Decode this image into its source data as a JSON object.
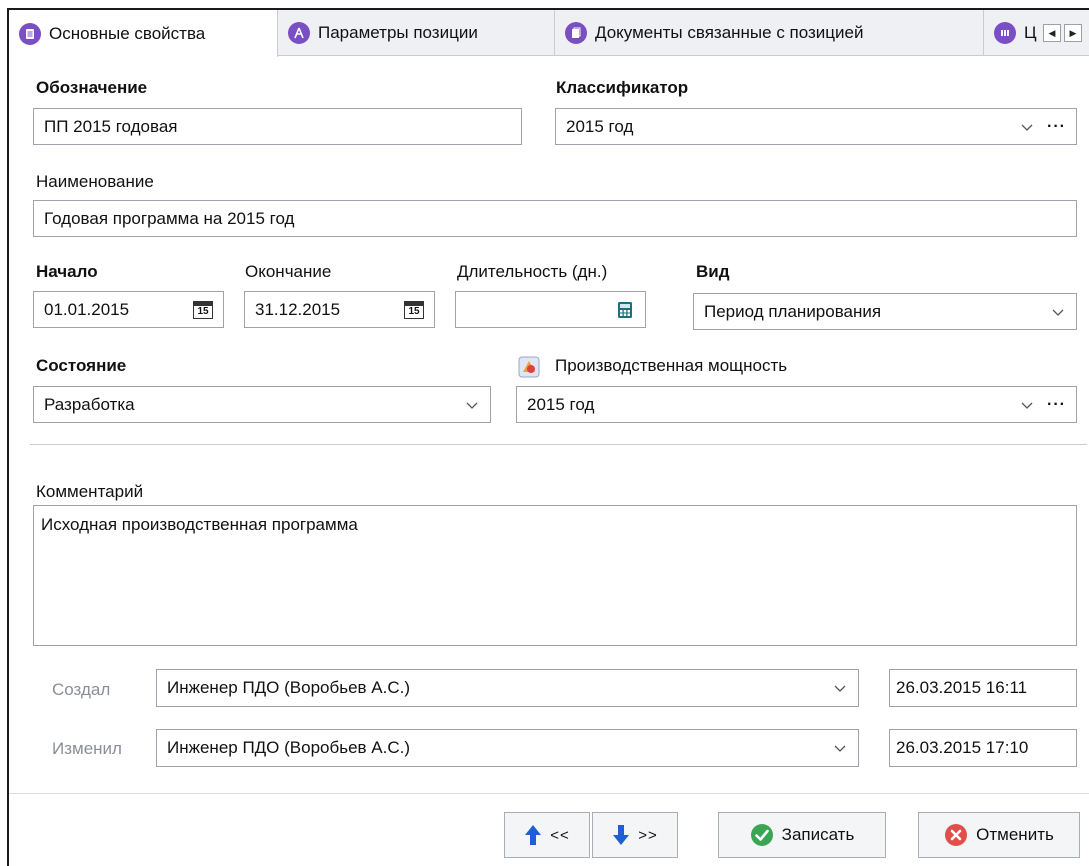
{
  "tabs": [
    {
      "label": "Основные свойства",
      "icon": "document-icon",
      "color": "#7b4fc4"
    },
    {
      "label": "Параметры позиции",
      "icon": "compass-icon",
      "color": "#7b4fc4"
    },
    {
      "label": "Документы связанные с позицией",
      "icon": "documents-icon",
      "color": "#7b4fc4"
    },
    {
      "label": "Ц",
      "icon": "stack-icon",
      "color": "#7b4fc4"
    }
  ],
  "form": {
    "designation_label": "Обозначение",
    "designation_value": "ПП 2015 годовая",
    "classifier_label": "Классификатор",
    "classifier_value": "2015 год",
    "name_label": "Наименование",
    "name_value": "Годовая программа на 2015 год",
    "start_label": "Начало",
    "start_value": "01.01.2015",
    "end_label": "Окончание",
    "end_value": "31.12.2015",
    "duration_label": "Длительность (дн.)",
    "duration_value": "",
    "kind_label": "Вид",
    "kind_value": "Период планирования",
    "state_label": "Состояние",
    "state_value": "Разработка",
    "capacity_label": "Производственная мощность",
    "capacity_value": "2015 год",
    "comment_label": "Комментарий",
    "comment_value": "Исходная производственная программа",
    "created_label": "Создал",
    "created_by": "Инженер ПДО (Воробьев А.С.)",
    "created_at": "26.03.2015 16:11",
    "modified_label": "Изменил",
    "modified_by": "Инженер ПДО (Воробьев А.С.)",
    "modified_at": "26.03.2015 17:10",
    "calendar_day": "15"
  },
  "buttons": {
    "prev_label": "<<",
    "next_label": ">>",
    "save_label": "Записать",
    "cancel_label": "Отменить"
  },
  "colors": {
    "accent_purple": "#7b4fc4",
    "arrow_blue": "#1f5fd6",
    "save_green": "#3aa655",
    "cancel_red": "#e0504a"
  }
}
